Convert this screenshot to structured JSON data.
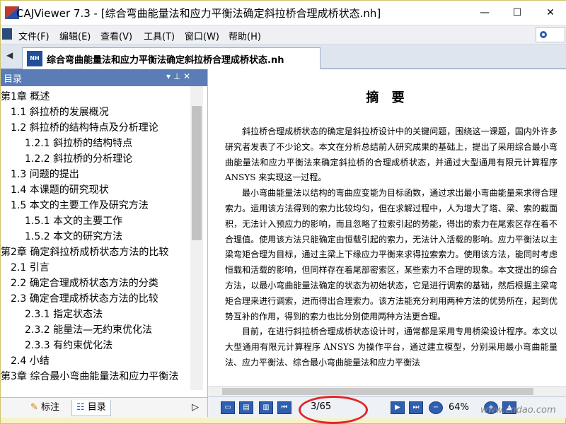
{
  "window": {
    "title": "CAJViewer 7.3 - [综合弯曲能量法和应力平衡法确定斜拉桥合理成桥状态.nh]",
    "minimize_glyph": "—",
    "maximize_glyph": "☐",
    "close_glyph": "✕"
  },
  "menu": [
    "文件(F)",
    "编辑(E)",
    "查看(V)",
    "工具(T)",
    "窗口(W)",
    "帮助(H)"
  ],
  "tab": {
    "label": "综合弯曲能量法和应力平衡法确定斜拉桥合理成桥状态.nh",
    "icon_text": "NH"
  },
  "panel": {
    "title": "目录",
    "pin_glyph": "▾ ⊥ ✕",
    "toc": [
      {
        "text": "第1章 概述",
        "level": 0
      },
      {
        "text": "1.1 斜拉桥的发展概况",
        "level": 1
      },
      {
        "text": "1.2 斜拉桥的结构特点及分析理论",
        "level": 1
      },
      {
        "text": "1.2.1 斜拉桥的结构特点",
        "level": 2
      },
      {
        "text": "1.2.2 斜拉桥的分析理论",
        "level": 2
      },
      {
        "text": "1.3 问题的提出",
        "level": 1
      },
      {
        "text": "1.4 本课题的研究现状",
        "level": 1
      },
      {
        "text": "1.5 本文的主要工作及研究方法",
        "level": 1
      },
      {
        "text": "1.5.1 本文的主要工作",
        "level": 2
      },
      {
        "text": "1.5.2 本文的研究方法",
        "level": 2
      },
      {
        "text": "第2章 确定斜拉桥成桥状态方法的比较",
        "level": 0
      },
      {
        "text": "2.1 引言",
        "level": 1
      },
      {
        "text": "2.2 确定合理成桥状态方法的分类",
        "level": 1
      },
      {
        "text": "2.3 确定合理成桥状态方法的比较",
        "level": 1
      },
      {
        "text": "2.3.1 指定状态法",
        "level": 2
      },
      {
        "text": "2.3.2 能量法—无约束优化法",
        "level": 2
      },
      {
        "text": "2.3.3 有约束优化法",
        "level": 2
      },
      {
        "text": "2.4 小结",
        "level": 1
      },
      {
        "text": "第3章 综合最小弯曲能量法和应力平衡法",
        "level": 0
      }
    ],
    "tabs": [
      "标注",
      "目录"
    ]
  },
  "document": {
    "heading": "摘  要",
    "paragraphs": [
      "斜拉桥合理成桥状态的确定是斜拉桥设计中的关键问题，围绕这一课题，国内外许多研究者发表了不少论文。本文在分析总结前人研究成果的基础上，提出了采用综合最小弯曲能量法和应力平衡法来确定斜拉桥的合理成桥状态，并通过大型通用有限元计算程序 ANSYS 来实现这一过程。",
      "最小弯曲能量法以结构的弯曲应变能为目标函数，通过求出最小弯曲能量来求得合理索力。运用该方法得到的索力比较均匀，但在求解过程中，人为增大了塔、梁、索的截面积，无法计入预应力的影响，而且忽略了拉索引起的势能，得出的索力在尾索区存在着不合理值。使用该方法只能确定由恒载引起的索力，无法计入活载的影响。应力平衡法以主梁弯矩合理为目标，通过主梁上下缘应力平衡来求得拉索索力。使用该方法，能同时考虑恒载和活载的影响，但同样存在着尾部密索区，某些索力不合理的现象。本文提出的综合方法，以最小弯曲能量法确定的状态为初始状态，它是进行调索的基础，然后根据主梁弯矩合理来进行调索，进而得出合理索力。该方法能充分利用两种方法的优势所在，起到优势互补的作用，得到的索力也比分别使用两种方法更合理。",
      "目前，在进行斜拉桥合理成桥状态设计时，通常都是采用专用桥梁设计程序。本文以大型通用有限元计算程序 ANSYS 为操作平台，通过建立模型，分别采用最小弯曲能量法、应力平衡法、综合最小弯曲能量法和应力平衡法"
    ]
  },
  "status": {
    "page": "3/65",
    "zoom": "64%"
  },
  "watermark": "www.cndao.com"
}
